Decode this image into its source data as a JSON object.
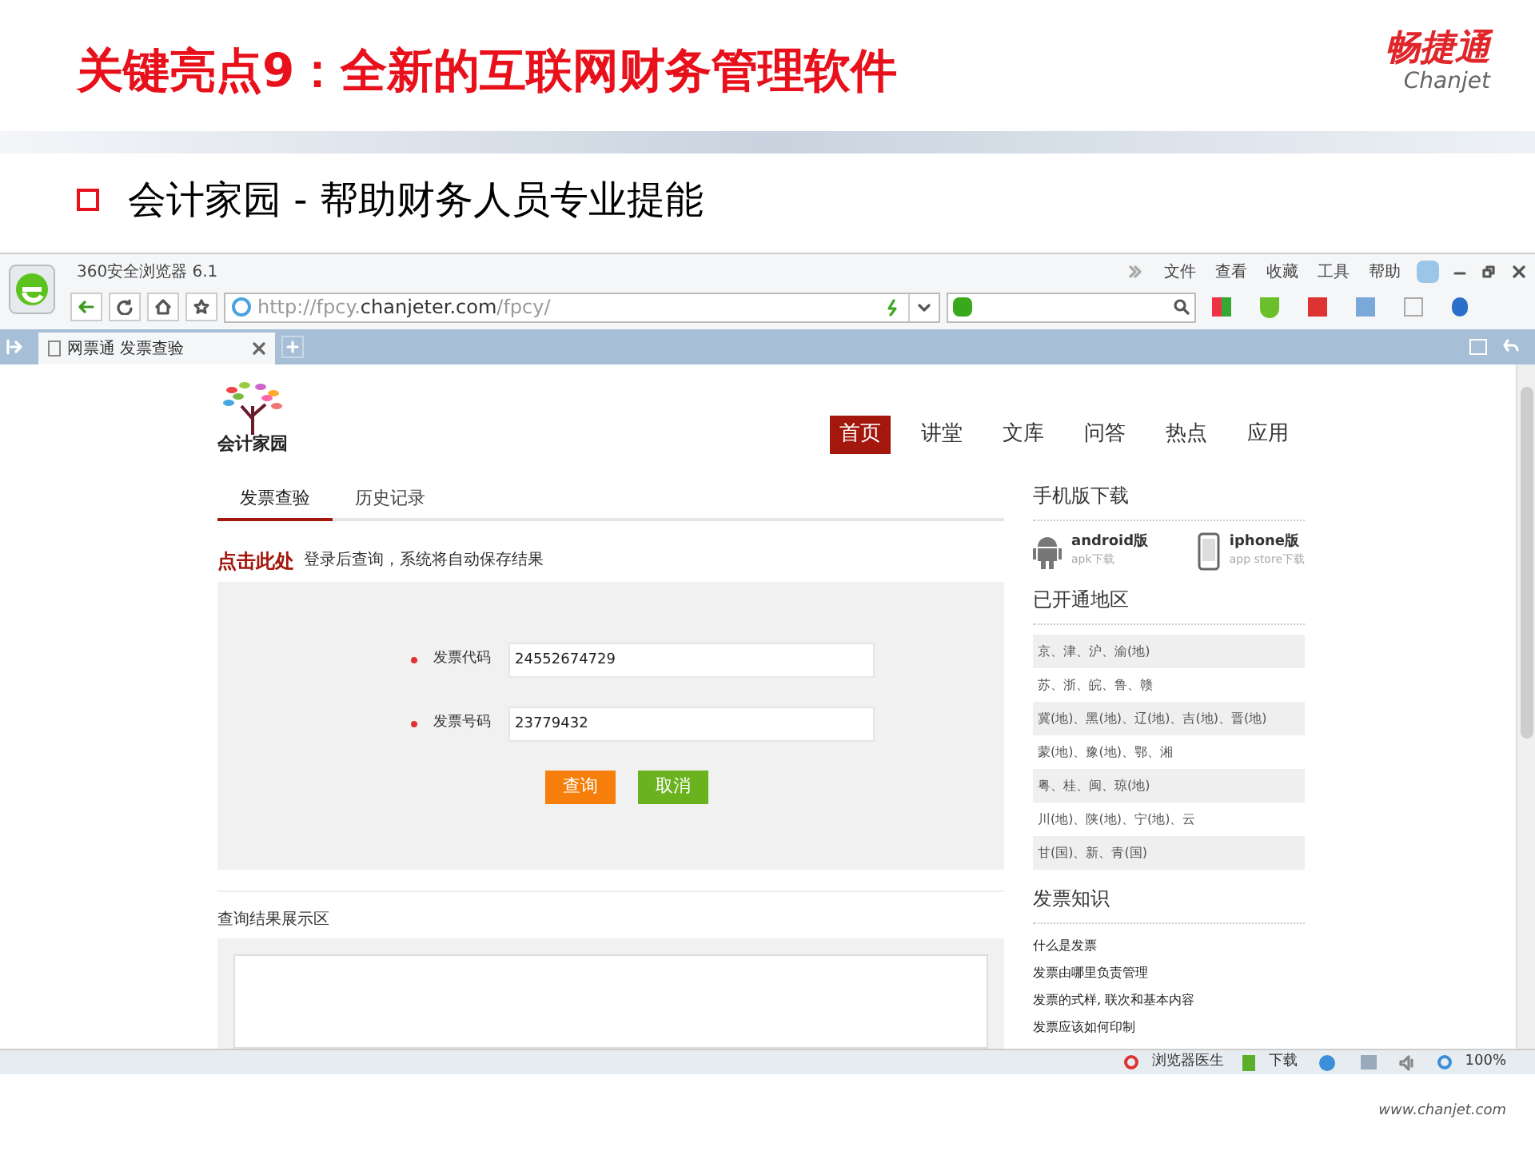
{
  "slide": {
    "title": "关键亮点9：全新的互联网财务管理软件",
    "brand": {
      "name": "畅捷通",
      "latin": "Chanjet"
    },
    "bullet": "会计家园 - 帮助财务人员专业提能",
    "footer": "www.chanjet.com"
  },
  "browser": {
    "title": "360安全浏览器 6.1",
    "menu": [
      "文件",
      "查看",
      "收藏",
      "工具",
      "帮助"
    ],
    "url": {
      "prefix": "http://fpcy.",
      "domain": "chanjeter.com",
      "suffix": "/fpcy/"
    },
    "tab": {
      "label": "网票通 发票查验"
    },
    "status_bar": {
      "doctor": "浏览器医生",
      "download": "下载",
      "zoom": "100%"
    }
  },
  "page": {
    "logo_text": "会计家园",
    "nav": [
      {
        "label": "首页",
        "selected": true
      },
      {
        "label": "讲堂",
        "selected": false
      },
      {
        "label": "文库",
        "selected": false
      },
      {
        "label": "问答",
        "selected": false
      },
      {
        "label": "热点",
        "selected": false
      },
      {
        "label": "应用",
        "selected": false
      }
    ],
    "tabs": [
      {
        "label": "发票查验",
        "selected": true
      },
      {
        "label": "历史记录",
        "selected": false
      }
    ],
    "hint": {
      "link": "点击此处",
      "text": "登录后查询，系统将自动保存结果"
    },
    "fields": [
      {
        "label": "发票代码",
        "required": true,
        "value": "24552674729"
      },
      {
        "label": "发票号码",
        "required": true,
        "value": "23779432"
      }
    ],
    "buttons": [
      {
        "label": "查询",
        "color": "#f57f0a"
      },
      {
        "label": "取消",
        "color": "#6ab31f"
      }
    ],
    "result_label": "查询结果展示区",
    "sidebar": {
      "download_heading": "手机版下载",
      "apps": [
        {
          "kind": "android",
          "name": "android版",
          "sub": "apk下载"
        },
        {
          "kind": "iphone",
          "name": "iphone版",
          "sub": "app store下载"
        }
      ],
      "regions_heading": "已开通地区",
      "regions": [
        "京、津、沪、渝(地)",
        "苏、浙、皖、鲁、赣",
        "冀(地)、黑(地)、辽(地)、吉(地)、晋(地)",
        "蒙(地)、豫(地)、鄂、湘",
        "粤、桂、闽、琼(地)",
        "川(地)、陕(地)、宁(地)、云",
        "甘(国)、新、青(国)"
      ],
      "knowledge_heading": "发票知识",
      "knowledge": [
        "什么是发票",
        "发票由哪里负责管理",
        "发票的式样, 联次和基本内容",
        "发票应该如何印制"
      ]
    }
  }
}
